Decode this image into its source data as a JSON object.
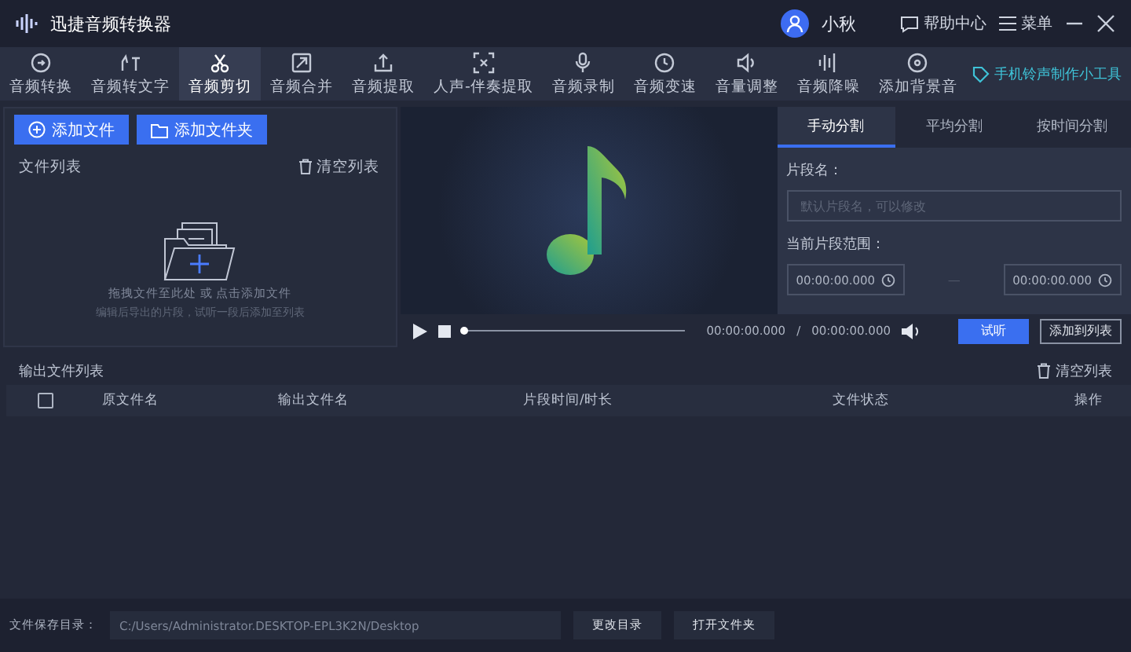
{
  "window": {
    "title": "迅捷音频转换器"
  },
  "user": {
    "name": "小秋"
  },
  "header_links": [
    {
      "label": "帮助中心",
      "kind": "help"
    },
    {
      "label": "菜单",
      "kind": "menu"
    }
  ],
  "toolbar": {
    "items": [
      {
        "label": "音频转换",
        "kind": "convert",
        "selected": false
      },
      {
        "label": "音频转文字",
        "kind": "text",
        "selected": false
      },
      {
        "label": "音频剪切",
        "kind": "scissors",
        "selected": true
      },
      {
        "label": "音频合并",
        "kind": "merge",
        "selected": false
      },
      {
        "label": "音频提取",
        "kind": "upload",
        "selected": false
      },
      {
        "label": "人声-伴奏提取",
        "kind": "scan",
        "selected": false
      },
      {
        "label": "音频录制",
        "kind": "mic",
        "selected": false
      },
      {
        "label": "音频变速",
        "kind": "clock",
        "selected": false
      },
      {
        "label": "音量调整",
        "kind": "speaker",
        "selected": false
      },
      {
        "label": "音频降噪",
        "kind": "bars",
        "selected": false
      },
      {
        "label": "添加背景音",
        "kind": "disc",
        "selected": false
      }
    ],
    "promo": "手机铃声制作小工具"
  },
  "file_panel": {
    "buttons": [
      {
        "label": "添加文件",
        "kind": "file"
      },
      {
        "label": "添加文件夹",
        "kind": "folder"
      }
    ],
    "title": "文件列表",
    "clear": "清空列表",
    "hint": "拖拽文件至此处 或 点击添加文件",
    "subhint": "编辑后导出的片段，试听一段后添加至列表"
  },
  "player": {
    "level": 0,
    "current": "00:00:00.000",
    "separator": "/",
    "total": "00:00:00.000",
    "buttons": [
      {
        "label": "试听",
        "kind": "primary"
      },
      {
        "label": "添加到列表",
        "kind": "outline"
      }
    ]
  },
  "split": {
    "tabs": [
      {
        "label": "手动分割",
        "selected": true
      },
      {
        "label": "平均分割",
        "selected": false
      },
      {
        "label": "按时间分割",
        "selected": false
      }
    ],
    "name_label": "片段名：",
    "name_placeholder": "默认片段名，可以修改",
    "range_label": "当前片段范围：",
    "start": "00:00:00.000",
    "range_separator": "—",
    "end": "00:00:00.000"
  },
  "output": {
    "title": "输出文件列表",
    "clear": "清空列表",
    "select_all_checked": false,
    "columns": [
      "原文件名",
      "输出文件名",
      "片段时间/时长",
      "文件状态",
      "操作"
    ]
  },
  "save_bar": {
    "label": "文件保存目录：",
    "path": "C:/Users/Administrator.DESKTOP-EPL3K2N/Desktop",
    "buttons": [
      "更改目录",
      "打开文件夹"
    ]
  }
}
